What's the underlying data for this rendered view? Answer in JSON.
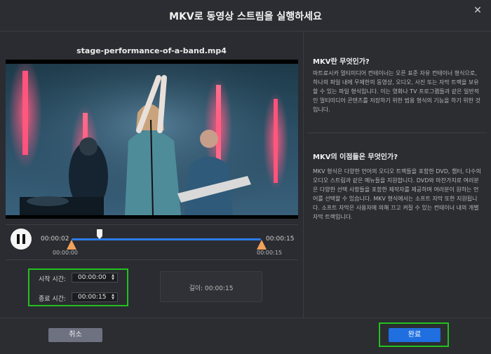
{
  "dialog": {
    "title": "MKV로 동영상 스트림을 실행하세요",
    "close_glyph": "✕"
  },
  "player": {
    "file_name": "stage-performance-of-a-band.mp4",
    "current_time": "00:00:02",
    "end_time": "00:00:15",
    "trim_start_label": "00:00:00",
    "trim_end_label": "00:00:15",
    "progress": 0.13,
    "trim_start_fraction": 0.0,
    "trim_end_fraction": 1.0,
    "state": "playing"
  },
  "trim": {
    "start_label": "시작 시간:",
    "start_value": "00:00:00",
    "end_label": "종료 시간:",
    "end_value": "00:00:15",
    "length_text": "길이: 00:00:15"
  },
  "info": {
    "heading1": "MKV란 무엇인가?",
    "body1": "마트료시카 멀티미디어 컨테이너는 오픈 표준 자유 컨테이너 형식으로, 하나의 파일 내에 무제한의 동영상, 오디오, 사진 또는 자막 트랙을 보유할 수 있는 파일 형식입니다. 이는 영화나 TV 프로그램들과 같은 일반적인 멀티미디어 콘텐츠를 저장하기 위한 범용 형식의 기능을 하기 위한 것입니다.",
    "heading2": "MKV의 이점들은 무엇인가?",
    "body2": "MKV 형식은 다양한 언어의 오디오 트랙들을 포함한 DVD, 챕터, 다수의 오디오 스트림과 같은 메뉴들을 지원합니다. DVD와 마찬가지로 여러분은 다양한 선택 사항들을 포함한 제작자를 제공하며 여러분이 원하는 언어를 선택할 수 있습니다. MKV 형식에서는 소프트 자막 또한 지원됩니다. 소프트 자막은 사용자에 의해 끄고 켜질 수 있는 컨테이너 내의 개별 자막 트랙입니다."
  },
  "footer": {
    "cancel_label": "취소",
    "done_label": "완료"
  },
  "colors": {
    "accent": "#1f6fe0",
    "track": "#2d7be8",
    "trim_handle": "#f0a15a",
    "highlight": "#23c11e"
  }
}
